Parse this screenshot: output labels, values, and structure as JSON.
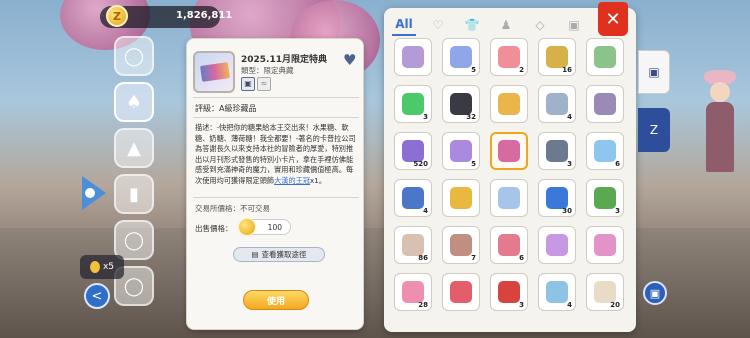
{
  "hud": {
    "currency": "1,826,811",
    "coin_glyph": "Z",
    "material_count": "x5"
  },
  "detail": {
    "title": "2025.11月限定特典",
    "type": "類型：限定典藏",
    "rank": "評級：A級珍藏品",
    "desc_main": "描述：-快把你的糖果給本王交出來！水果糖、軟糖、奶糖、薄荷糖！我全都要！-著名的卡普拉公司為答謝長久以來支持本社的冒險者的厚愛，特別推出以月刊形式發售的特別小卡片，拿在手裡仿佛能感受到充滿神奇的魔力，實用和珍藏價值極高。每次使用均可獲得限定頭飾",
    "desc_link": "大漢的王冠",
    "desc_tail": "x1。",
    "trade": "交易所價格：不可交易",
    "price_label": "出售價格：",
    "price": "100",
    "source_btn": "查看獲取途徑",
    "use_btn": "使用"
  },
  "inventory": {
    "tabs": [
      "All",
      "heart-icon",
      "shirt-icon",
      "figure-icon",
      "gem-icon",
      "card-icon"
    ],
    "close": "✕",
    "items": [
      {
        "icon": "purple-gem",
        "count": "",
        "color": "#b59ad8"
      },
      {
        "icon": "gift-box",
        "count": "5",
        "color": "#8fa6e8"
      },
      {
        "icon": "pink-slime",
        "count": "2",
        "color": "#f08f9a"
      },
      {
        "icon": "gold-ring",
        "count": "16",
        "color": "#d6b14a"
      },
      {
        "icon": "green-bowl",
        "count": "",
        "color": "#8bc48a"
      },
      {
        "icon": "lightning",
        "count": "3",
        "color": "#4ec96a"
      },
      {
        "icon": "coal-ore",
        "count": "32",
        "color": "#3a3a44"
      },
      {
        "icon": "gold-leaf",
        "count": "",
        "color": "#eab54a"
      },
      {
        "icon": "mortar-bowl",
        "count": "4",
        "color": "#9eb3c9"
      },
      {
        "icon": "purple-stone",
        "count": "",
        "color": "#9a8ab5"
      },
      {
        "icon": "purple-crystal",
        "count": "520",
        "color": "#8d6fd4"
      },
      {
        "icon": "purple-card",
        "count": "5",
        "color": "#a98adf"
      },
      {
        "icon": "photo-card",
        "count": "",
        "color": "#d86aa2"
      },
      {
        "icon": "silver-needle",
        "count": "3",
        "color": "#6c7a90"
      },
      {
        "icon": "ice-star",
        "count": "6",
        "color": "#8ec6ef"
      },
      {
        "icon": "blue-card",
        "count": "4",
        "color": "#4c76c8"
      },
      {
        "icon": "gold-coin",
        "count": "",
        "color": "#e9b83e"
      },
      {
        "icon": "blue-scroll",
        "count": "",
        "color": "#a7c4ea"
      },
      {
        "icon": "blue-gem",
        "count": "30",
        "color": "#3b78d8"
      },
      {
        "icon": "green-potion",
        "count": "3",
        "color": "#5aa84f"
      },
      {
        "icon": "blade-shard",
        "count": "86",
        "color": "#d9c1b1"
      },
      {
        "icon": "stone-bowl",
        "count": "7",
        "color": "#c08f82"
      },
      {
        "icon": "candy",
        "count": "6",
        "color": "#e47a8d"
      },
      {
        "icon": "pink-crystal",
        "count": "",
        "color": "#c798e3"
      },
      {
        "icon": "pink-potion",
        "count": "",
        "color": "#e293c8"
      },
      {
        "icon": "lollipop",
        "count": "28",
        "color": "#ef8fb0"
      },
      {
        "icon": "100w-badge",
        "count": "",
        "color": "#e35d6a"
      },
      {
        "icon": "red-gift",
        "count": "3",
        "color": "#d8443d"
      },
      {
        "icon": "ice-crystal",
        "count": "4",
        "color": "#8fc3e6"
      },
      {
        "icon": "bone",
        "count": "20",
        "color": "#e8dcc7"
      }
    ]
  }
}
